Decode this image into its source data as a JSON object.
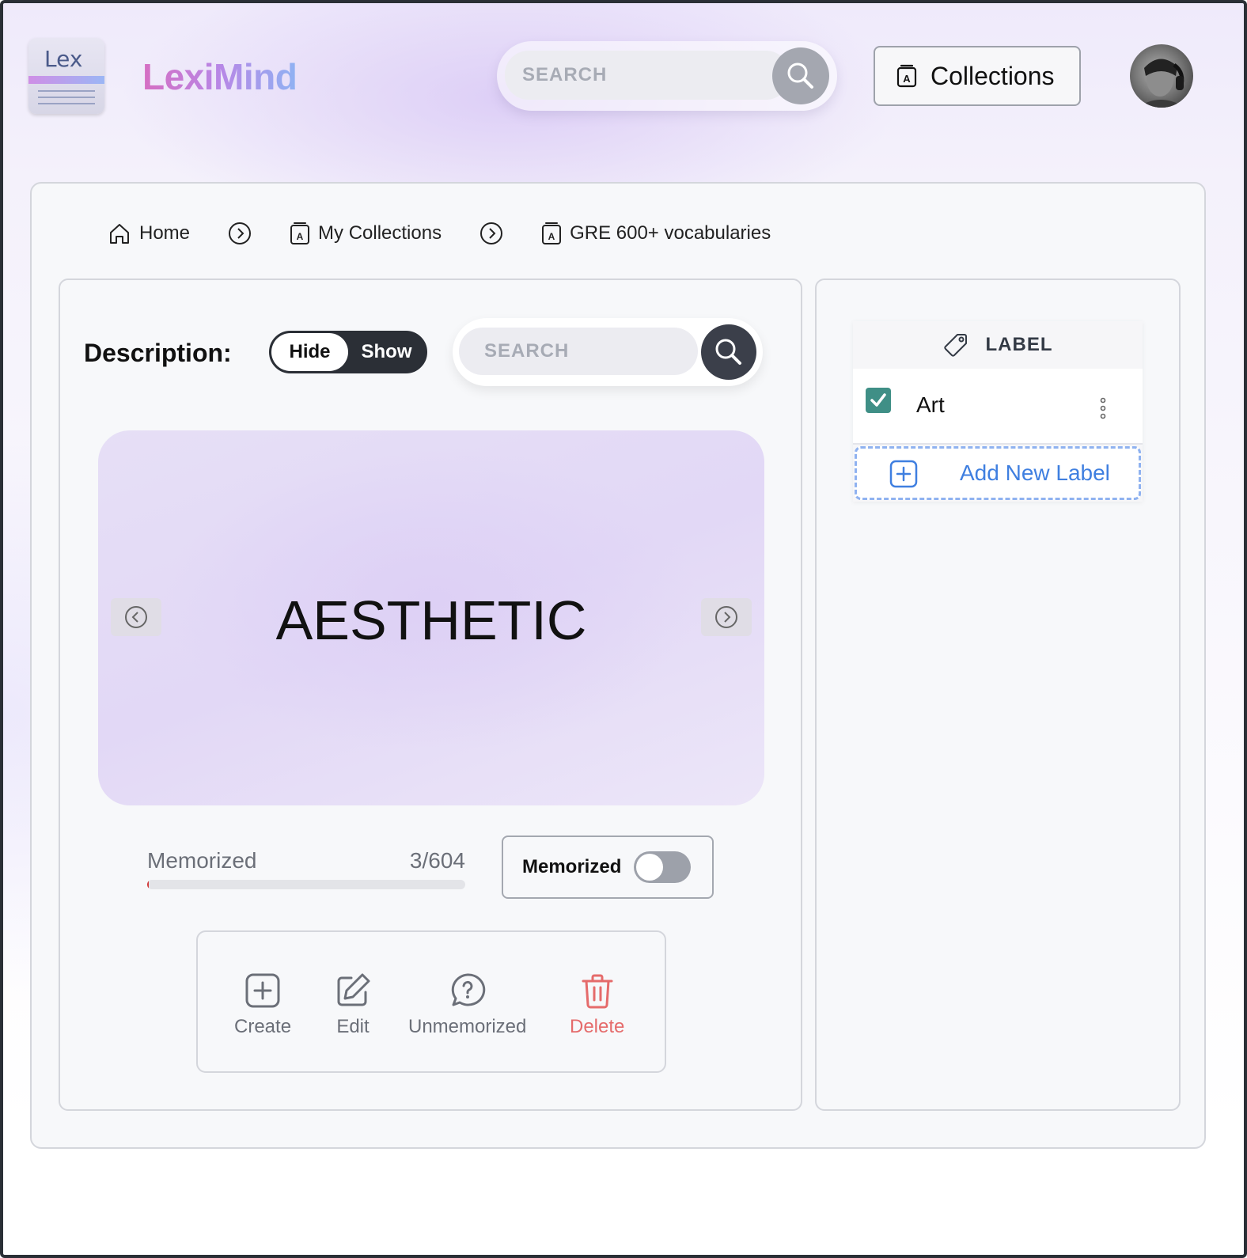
{
  "header": {
    "logo_text": "Lex",
    "brand": "LexiMind",
    "search_placeholder": "SEARCH",
    "collections_label": "Collections"
  },
  "breadcrumb": {
    "items": [
      "Home",
      "My Collections",
      "GRE 600+ vocabularies"
    ]
  },
  "description": {
    "label": "Description:",
    "hide_label": "Hide",
    "show_label": "Show",
    "active": "Hide",
    "search_placeholder": "SEARCH"
  },
  "card": {
    "word": "AESTHETIC"
  },
  "progress": {
    "label": "Memorized",
    "count_text": "3/604",
    "memorized": 3,
    "total": 604
  },
  "memorized_toggle": {
    "label": "Memorized",
    "on": false
  },
  "actions": {
    "create": "Create",
    "edit": "Edit",
    "unmemorized": "Unmemorized",
    "delete": "Delete"
  },
  "labels": {
    "heading": "LABEL",
    "items": [
      {
        "name": "Art",
        "checked": true
      }
    ],
    "add_label": "Add New Label"
  },
  "colors": {
    "accent_blue": "#3f7fe0",
    "checkbox": "#3f8f86",
    "danger": "#e56b6b",
    "progress_fill": "#d23b3b"
  }
}
